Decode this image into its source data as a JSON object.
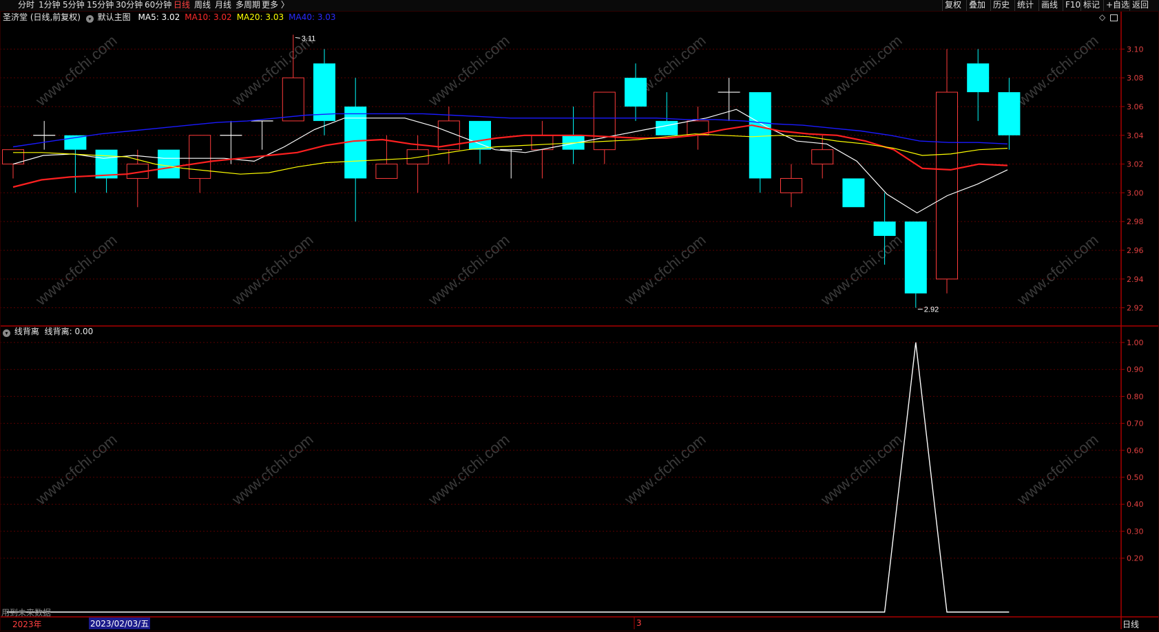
{
  "toolbar": {
    "periods": [
      "分时",
      "1分钟",
      "5分钟",
      "15分钟",
      "30分钟",
      "60分钟",
      "日线",
      "周线",
      "月线",
      "多周期",
      "更多 〉"
    ],
    "active_period": "日线",
    "right_buttons": [
      "复权",
      "叠加",
      "历史",
      "统计",
      "画线",
      "F10",
      "标记",
      "+自选",
      "返回"
    ]
  },
  "main_panel": {
    "stock_title": "圣济堂 (日线,前复权)",
    "template_label": "默认主图",
    "ma_readouts": [
      {
        "label": "MA5: 3.02",
        "color": "#ffffff"
      },
      {
        "label": "MA10: 3.02",
        "color": "#ff2a2a"
      },
      {
        "label": "MA20: 3.03",
        "color": "#ffff00"
      },
      {
        "label": "MA40: 3.03",
        "color": "#2a2aff"
      }
    ],
    "high_marker": "3.11",
    "low_marker": "2.92",
    "price_ticks": [
      "3.10",
      "3.08",
      "3.06",
      "3.04",
      "3.02",
      "3.00",
      "2.98",
      "2.96",
      "2.94",
      "2.92"
    ],
    "icons": [
      "diamond-icon",
      "window-icon"
    ]
  },
  "indicator_panel": {
    "title": "线背离",
    "value_label": "线背离: 0.00",
    "ticks": [
      "1.00",
      "0.90",
      "0.80",
      "0.70",
      "0.60",
      "0.50",
      "0.40",
      "0.30",
      "0.20"
    ],
    "note": "用到未来数据"
  },
  "bottom_bar": {
    "year_label": "2023年",
    "cursor_date": "2023/02/03/五",
    "month_label": "3",
    "period_label": "日线"
  },
  "watermark": "www.cfchi.com",
  "colors": {
    "up": "#ff3b3b",
    "down": "#00ffff",
    "neutral": "#ffffff",
    "axis": "#aa0000",
    "grid": "#5a0000",
    "ma5": "#ffffff",
    "ma10": "#ff2020",
    "ma20": "#ffff00",
    "ma40": "#1a1aff"
  },
  "chart_data": {
    "type": "candlestick",
    "title": "圣济堂 (日线,前复权)",
    "ylim": [
      2.915,
      3.115
    ],
    "candles": [
      {
        "o": 3.02,
        "h": 3.03,
        "l": 3.01,
        "c": 3.03
      },
      {
        "o": 3.04,
        "h": 3.05,
        "l": 3.03,
        "c": 3.04
      },
      {
        "o": 3.04,
        "h": 3.04,
        "l": 3.0,
        "c": 3.03
      },
      {
        "o": 3.03,
        "h": 3.03,
        "l": 3.0,
        "c": 3.01
      },
      {
        "o": 3.01,
        "h": 3.03,
        "l": 2.99,
        "c": 3.02
      },
      {
        "o": 3.03,
        "h": 3.03,
        "l": 3.01,
        "c": 3.01
      },
      {
        "o": 3.01,
        "h": 3.04,
        "l": 3.0,
        "c": 3.04
      },
      {
        "o": 3.04,
        "h": 3.05,
        "l": 3.02,
        "c": 3.04
      },
      {
        "o": 3.05,
        "h": 3.05,
        "l": 3.03,
        "c": 3.05
      },
      {
        "o": 3.05,
        "h": 3.11,
        "l": 3.05,
        "c": 3.08
      },
      {
        "o": 3.09,
        "h": 3.1,
        "l": 3.04,
        "c": 3.05
      },
      {
        "o": 3.06,
        "h": 3.08,
        "l": 2.98,
        "c": 3.01
      },
      {
        "o": 3.01,
        "h": 3.04,
        "l": 3.01,
        "c": 3.02
      },
      {
        "o": 3.02,
        "h": 3.04,
        "l": 3.0,
        "c": 3.03
      },
      {
        "o": 3.03,
        "h": 3.06,
        "l": 3.02,
        "c": 3.05
      },
      {
        "o": 3.05,
        "h": 3.05,
        "l": 3.02,
        "c": 3.03
      },
      {
        "o": 3.03,
        "h": 3.03,
        "l": 3.01,
        "c": 3.03
      },
      {
        "o": 3.03,
        "h": 3.05,
        "l": 3.01,
        "c": 3.04
      },
      {
        "o": 3.04,
        "h": 3.06,
        "l": 3.02,
        "c": 3.03
      },
      {
        "o": 3.03,
        "h": 3.07,
        "l": 3.02,
        "c": 3.07
      },
      {
        "o": 3.08,
        "h": 3.09,
        "l": 3.05,
        "c": 3.06
      },
      {
        "o": 3.05,
        "h": 3.07,
        "l": 3.04,
        "c": 3.04
      },
      {
        "o": 3.04,
        "h": 3.06,
        "l": 3.03,
        "c": 3.05
      },
      {
        "o": 3.07,
        "h": 3.08,
        "l": 3.05,
        "c": 3.07
      },
      {
        "o": 3.07,
        "h": 3.07,
        "l": 3.0,
        "c": 3.01
      },
      {
        "o": 3.0,
        "h": 3.02,
        "l": 2.99,
        "c": 3.01
      },
      {
        "o": 3.02,
        "h": 3.04,
        "l": 3.01,
        "c": 3.03
      },
      {
        "o": 3.01,
        "h": 3.01,
        "l": 2.99,
        "c": 2.99
      },
      {
        "o": 2.98,
        "h": 3.0,
        "l": 2.95,
        "c": 2.97
      },
      {
        "o": 2.98,
        "h": 2.98,
        "l": 2.92,
        "c": 2.93
      },
      {
        "o": 2.94,
        "h": 3.1,
        "l": 2.93,
        "c": 3.07
      },
      {
        "o": 3.09,
        "h": 3.1,
        "l": 3.05,
        "c": 3.07
      },
      {
        "o": 3.07,
        "h": 3.08,
        "l": 3.03,
        "c": 3.04
      }
    ],
    "ma_series": [
      {
        "name": "MA5",
        "values": [
          3.02,
          3.026,
          3.027,
          3.024,
          3.026,
          3.024,
          3.024,
          3.024,
          3.022,
          3.032,
          3.044,
          3.052,
          3.052,
          3.052,
          3.046,
          3.038,
          3.03,
          3.028,
          3.032,
          3.036,
          3.04,
          3.044,
          3.048,
          3.052,
          3.058,
          3.046,
          3.036,
          3.034,
          3.022,
          2.999,
          2.986,
          2.998,
          3.006,
          3.016
        ]
      },
      {
        "name": "MA10",
        "values": [
          3.004,
          3.009,
          3.011,
          3.012,
          3.013,
          3.016,
          3.019,
          3.022,
          3.024,
          3.026,
          3.028,
          3.033,
          3.036,
          3.037,
          3.034,
          3.032,
          3.035,
          3.038,
          3.04,
          3.04,
          3.04,
          3.039,
          3.038,
          3.038,
          3.04,
          3.044,
          3.047,
          3.043,
          3.041,
          3.04,
          3.036,
          3.03,
          3.017,
          3.016,
          3.02,
          3.019
        ]
      },
      {
        "name": "MA20",
        "values": [
          3.028,
          3.028,
          3.027,
          3.026,
          3.025,
          3.02,
          3.017,
          3.015,
          3.013,
          3.014,
          3.018,
          3.021,
          3.022,
          3.023,
          3.024,
          3.027,
          3.03,
          3.032,
          3.033,
          3.034,
          3.035,
          3.036,
          3.037,
          3.039,
          3.041,
          3.04,
          3.039,
          3.04,
          3.039,
          3.036,
          3.034,
          3.031,
          3.026,
          3.027,
          3.03,
          3.031
        ]
      },
      {
        "name": "MA40",
        "values": [
          3.032,
          3.035,
          3.038,
          3.041,
          3.043,
          3.045,
          3.047,
          3.049,
          3.05,
          3.052,
          3.054,
          3.055,
          3.055,
          3.055,
          3.055,
          3.054,
          3.053,
          3.052,
          3.052,
          3.052,
          3.052,
          3.052,
          3.052,
          3.051,
          3.051,
          3.05,
          3.048,
          3.047,
          3.045,
          3.043,
          3.04,
          3.036,
          3.035,
          3.035,
          3.034
        ]
      }
    ],
    "indicator": {
      "name": "线背离",
      "ylim": [
        0,
        1.0
      ],
      "values": [
        0,
        0,
        0,
        0,
        0,
        0,
        0,
        0,
        0,
        0,
        0,
        0,
        0,
        0,
        0,
        0,
        0,
        0,
        0,
        0,
        0,
        0,
        0,
        0,
        0,
        0,
        0,
        0,
        0,
        1,
        0,
        0,
        0
      ]
    }
  }
}
